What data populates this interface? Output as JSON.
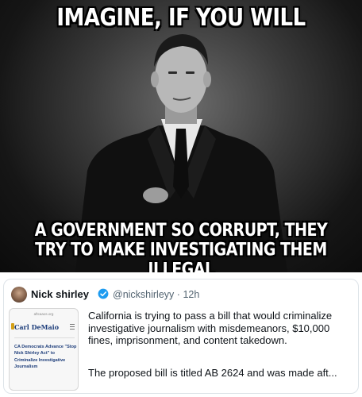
{
  "meme": {
    "top_caption": "IMAGINE, IF YOU WILL",
    "bottom_line1": "A GOVERNMENT SO CORRUPT, THEY",
    "bottom_line2": "TRY TO MAKE INVESTIGATING THEM ILLEGAL"
  },
  "tweet": {
    "name": "Nick shirley",
    "handle": "@nickshirleyy",
    "separator": "·",
    "time": "12h",
    "body1": "California is trying to pass a bill that would criminalize investigative journalism with misdemeanors, $10,000 fines, imprisonment, and content takedown.",
    "body2": "The proposed bill is titled AB 2624 and was made aft...",
    "verified_icon": "verified-badge-icon",
    "verified_color": "#1d9bf0",
    "thumbnail": {
      "site": "aftcaaos.org",
      "brand": "Carl DeMaio",
      "headline": "CA Democrats Advance \"Stop Nick Shirley Act\" to Criminalize Investigative Journalism"
    }
  }
}
